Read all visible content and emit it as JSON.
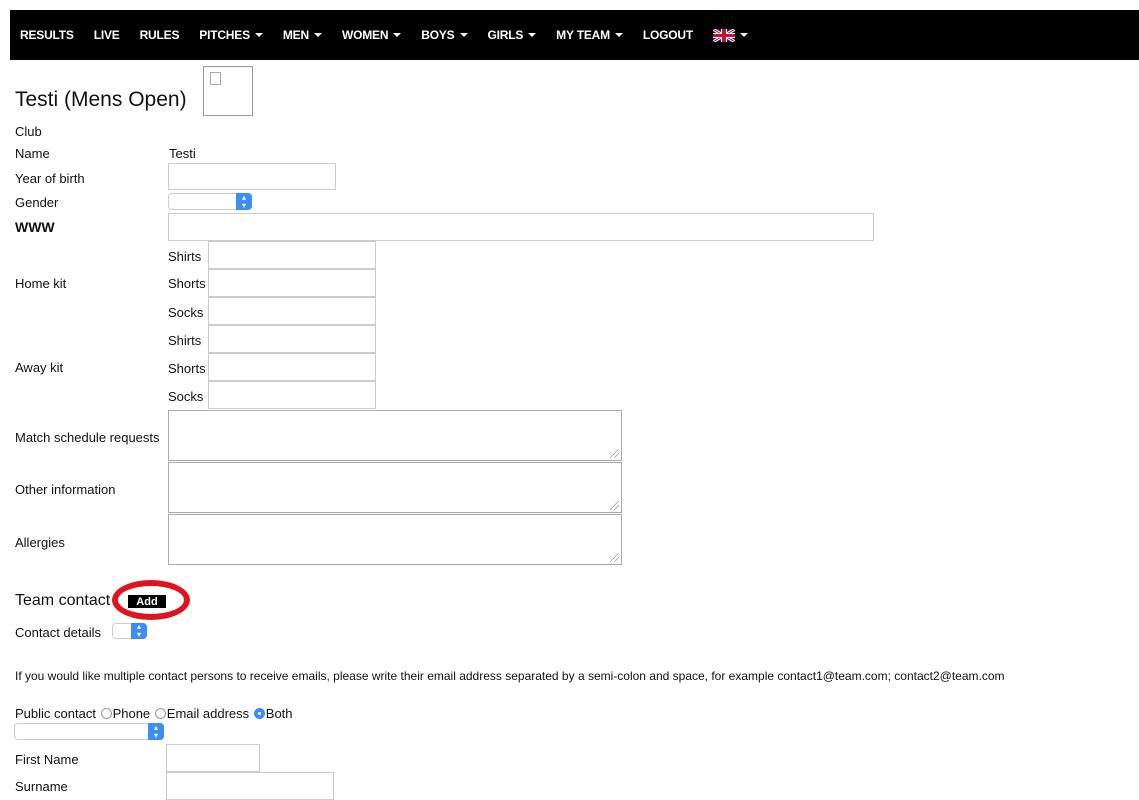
{
  "nav": {
    "items": [
      {
        "label": "RESULTS",
        "caret": false
      },
      {
        "label": "LIVE",
        "caret": false
      },
      {
        "label": "RULES",
        "caret": false
      },
      {
        "label": "PITCHES",
        "caret": true
      },
      {
        "label": "MEN",
        "caret": true
      },
      {
        "label": "WOMEN",
        "caret": true
      },
      {
        "label": "BOYS",
        "caret": true
      },
      {
        "label": "GIRLS",
        "caret": true
      },
      {
        "label": "MY TEAM",
        "caret": true
      },
      {
        "label": "LOGOUT",
        "caret": false
      }
    ],
    "language_icon": "uk-flag-icon"
  },
  "page_title": "Testi (Mens Open)",
  "form": {
    "club_label": "Club",
    "name_label": "Name",
    "name_value": "Testi",
    "year_label": "Year of birth",
    "year_value": "",
    "gender_label": "Gender",
    "gender_value": "",
    "www_label": "WWW",
    "www_value": "",
    "home_kit_label": "Home kit",
    "away_kit_label": "Away kit",
    "shirts_label": "Shirts",
    "shorts_label": "Shorts",
    "socks_label": "Socks",
    "match_schedule_label": "Match schedule requests",
    "other_info_label": "Other information",
    "allergies_label": "Allergies"
  },
  "contact": {
    "heading": "Team contact",
    "add_label": "Add",
    "details_label": "Contact details",
    "note": "If you would like multiple contact persons to receive emails, please write their email address separated by a semi-colon and space, for example contact1@team.com; contact2@team.com",
    "public_label": "Public contact",
    "options": [
      "Phone",
      "Email address",
      "Both"
    ],
    "selected": "Both",
    "first_name_label": "First Name",
    "surname_label": "Surname"
  },
  "colors": {
    "navbar": "#000000",
    "accent": "#3b8ef3",
    "highlight_ring": "#e0141e"
  }
}
